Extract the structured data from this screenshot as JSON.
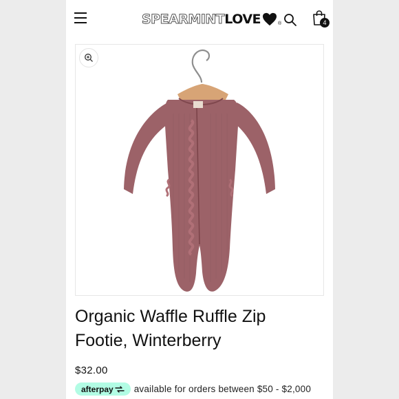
{
  "header": {
    "brand_light": "SPEARMINT",
    "brand_bold": "LOVE",
    "brand_reg": "®",
    "cart_count": "4",
    "icons": [
      "menu-icon",
      "search-icon",
      "cart-bag-icon"
    ]
  },
  "product": {
    "image_alt": "Organic Waffle Ruffle Zip Footie in Winterberry on a wooden hanger",
    "garment_color": "#9c6268",
    "zoom_icon": "zoom-in-icon",
    "title": "Organic Waffle Ruffle Zip Footie, Winterberry",
    "price": "$32.00"
  },
  "afterpay": {
    "badge_label": "afterpay",
    "badge_color": "#b2fce4",
    "text": "available for orders between $50 - $2,000"
  }
}
